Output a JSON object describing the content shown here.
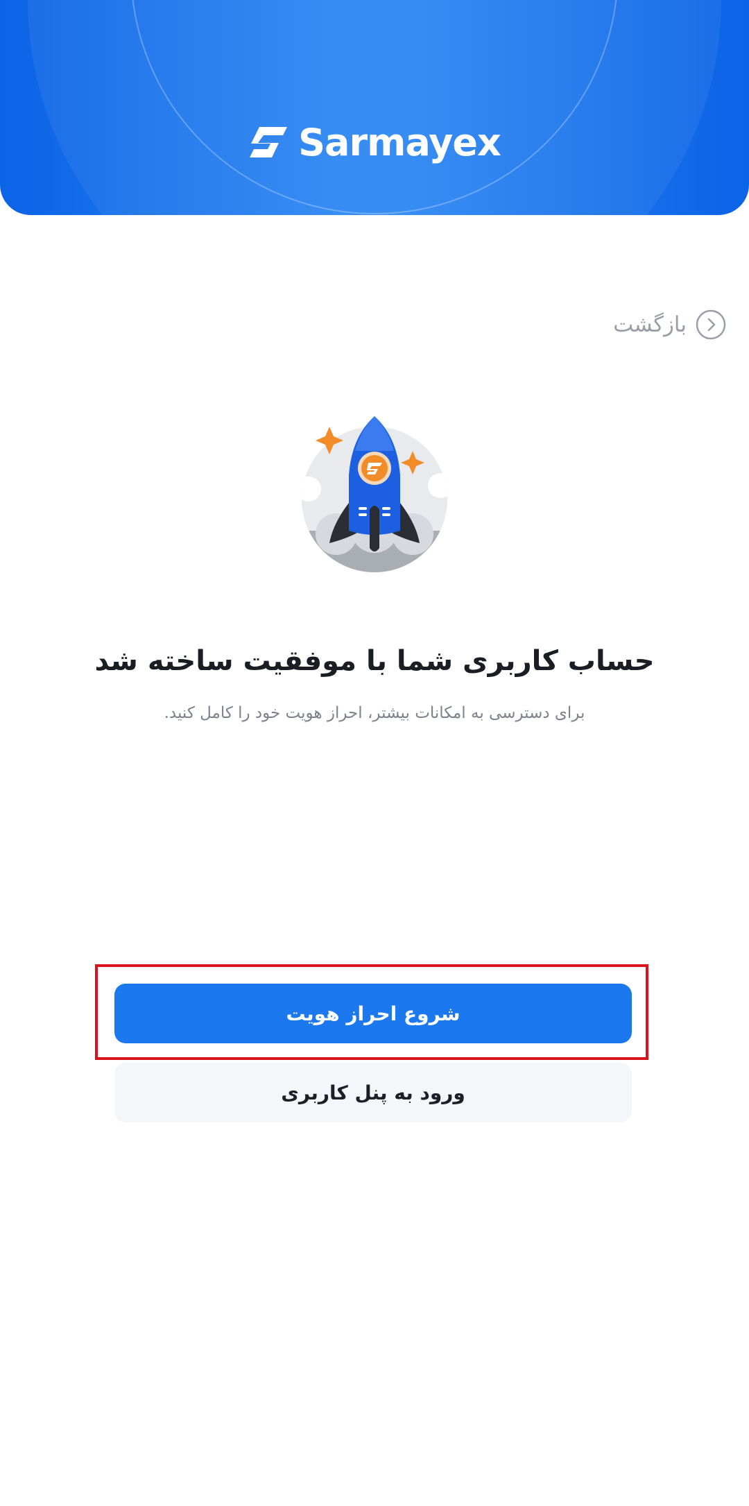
{
  "header": {
    "brand_name": "Sarmayex",
    "brand_icon": "sarmayex-logo-icon",
    "colors": {
      "primary": "#1c78ee",
      "header_dark": "#0b63e6",
      "header_light": "#2c86f3",
      "accent_orange": "#f28c28"
    }
  },
  "navigation": {
    "back_label": "بازگشت",
    "back_icon": "chevron-right-circle-icon"
  },
  "illustration": {
    "icon": "rocket-launch-icon"
  },
  "content": {
    "title": "حساب کاربری شما با موفقیت ساخته شد",
    "subtitle": "برای دسترسی به امکانات بیشتر، احراز هویت خود را کامل کنید."
  },
  "actions": {
    "start_verification_label": "شروع احراز هویت",
    "enter_panel_label": "ورود به پنل کاربری"
  }
}
